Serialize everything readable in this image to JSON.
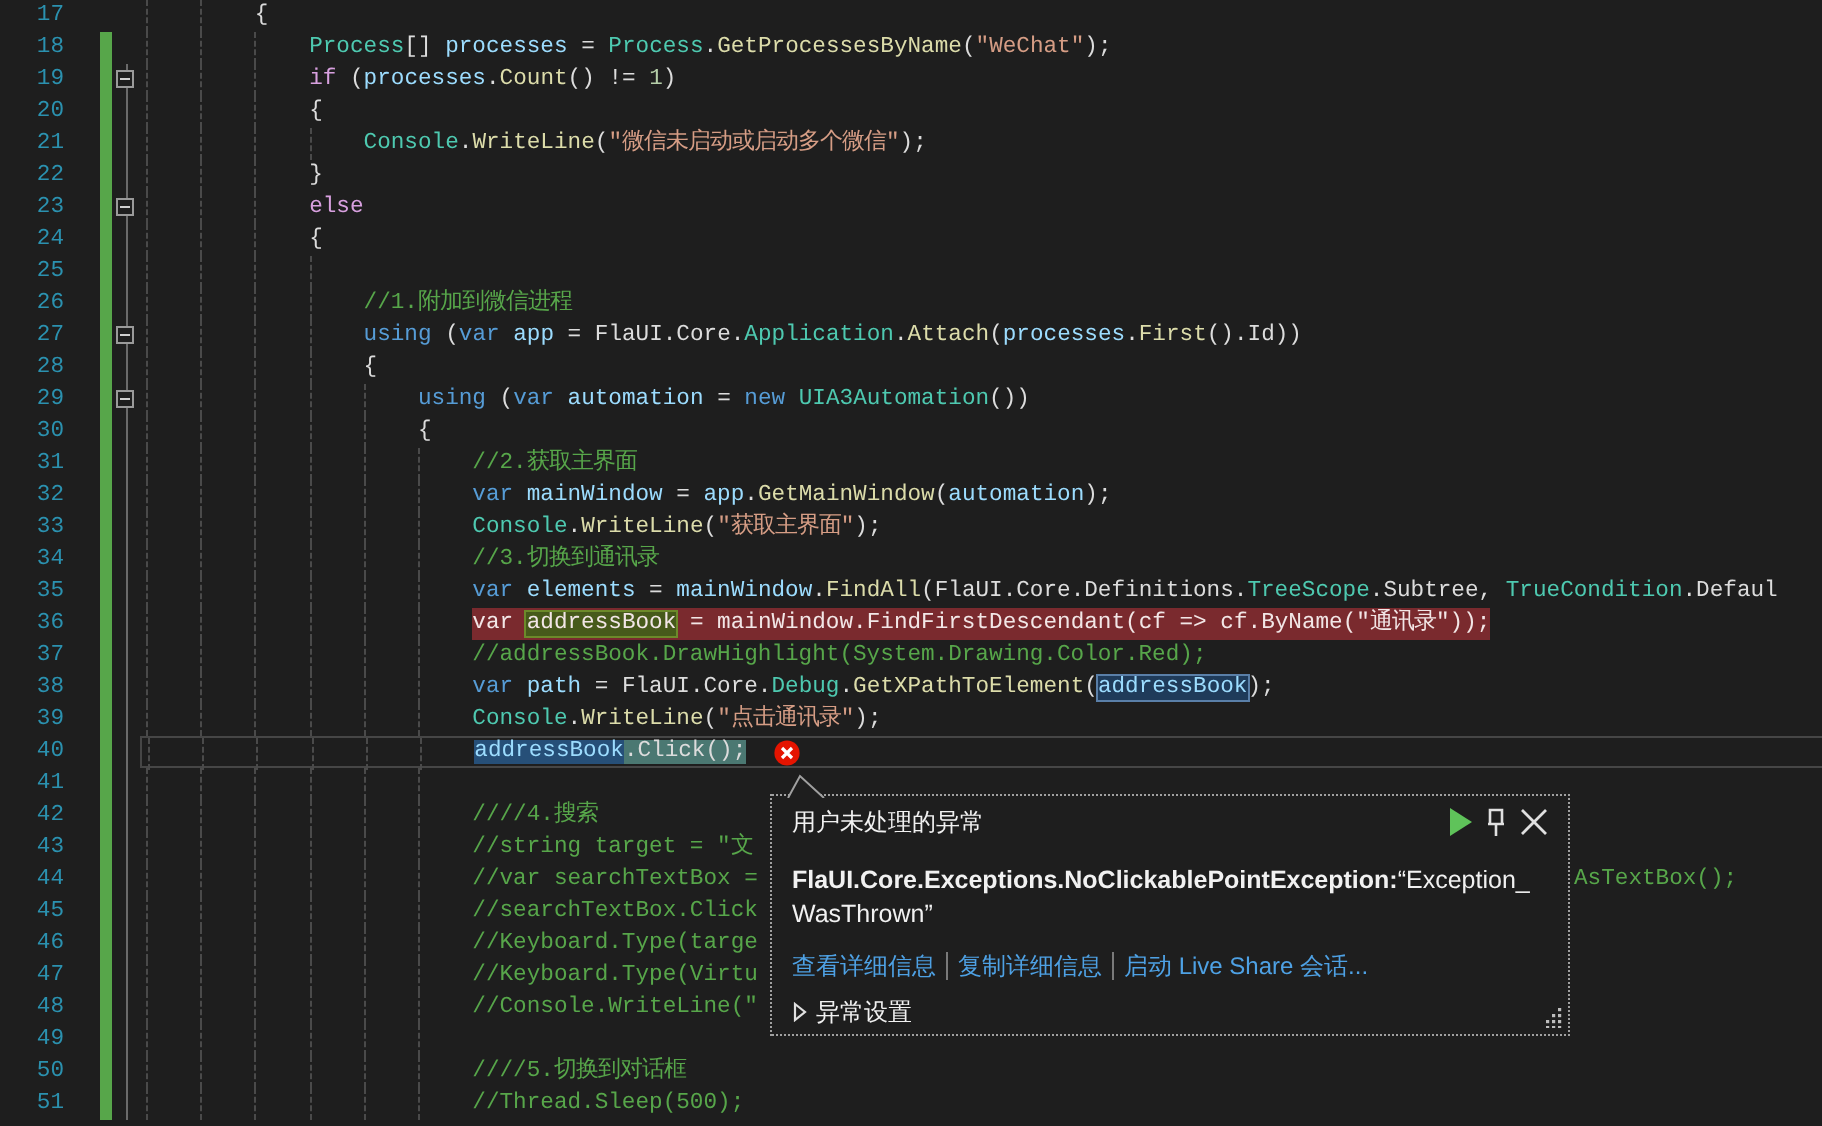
{
  "lines": [
    {
      "number": "17",
      "changed": false,
      "fold": false,
      "tokens": [
        {
          "text": "        {",
          "kind": "plain"
        }
      ]
    },
    {
      "number": "18",
      "changed": true,
      "fold": false,
      "tokens": [
        {
          "text": "            Process",
          "kind": "type"
        },
        {
          "text": "[] ",
          "kind": "plain"
        },
        {
          "text": "processes",
          "kind": "variable"
        },
        {
          "text": " = ",
          "kind": "plain"
        },
        {
          "text": "Process",
          "kind": "type"
        },
        {
          "text": ".",
          "kind": "plain"
        },
        {
          "text": "GetProcessesByName",
          "kind": "method"
        },
        {
          "text": "(",
          "kind": "plain"
        },
        {
          "text": "\"WeChat\"",
          "kind": "string"
        },
        {
          "text": ");",
          "kind": "plain"
        }
      ]
    },
    {
      "number": "19",
      "changed": true,
      "fold": true,
      "tokens": [
        {
          "text": "            if",
          "kind": "control"
        },
        {
          "text": " (",
          "kind": "plain"
        },
        {
          "text": "processes",
          "kind": "variable"
        },
        {
          "text": ".",
          "kind": "plain"
        },
        {
          "text": "Count",
          "kind": "method"
        },
        {
          "text": "() != ",
          "kind": "plain"
        },
        {
          "text": "1",
          "kind": "number"
        },
        {
          "text": ")",
          "kind": "plain"
        }
      ]
    },
    {
      "number": "20",
      "changed": true,
      "fold": false,
      "tokens": [
        {
          "text": "            {",
          "kind": "plain"
        }
      ]
    },
    {
      "number": "21",
      "changed": true,
      "fold": false,
      "tokens": [
        {
          "text": "                Console",
          "kind": "type"
        },
        {
          "text": ".",
          "kind": "plain"
        },
        {
          "text": "WriteLine",
          "kind": "method"
        },
        {
          "text": "(",
          "kind": "plain"
        },
        {
          "text": "\"微信未启动或启动多个微信\"",
          "kind": "string"
        },
        {
          "text": ");",
          "kind": "plain"
        }
      ]
    },
    {
      "number": "22",
      "changed": true,
      "fold": false,
      "tokens": [
        {
          "text": "            }",
          "kind": "plain"
        }
      ]
    },
    {
      "number": "23",
      "changed": true,
      "fold": true,
      "tokens": [
        {
          "text": "            else",
          "kind": "control"
        }
      ]
    },
    {
      "number": "24",
      "changed": true,
      "fold": false,
      "tokens": [
        {
          "text": "            {",
          "kind": "plain"
        }
      ]
    },
    {
      "number": "25",
      "changed": true,
      "fold": false
    },
    {
      "number": "26",
      "changed": true,
      "fold": false,
      "tokens": [
        {
          "text": "                //1.附加到微信进程",
          "kind": "comment"
        }
      ]
    },
    {
      "number": "27",
      "changed": true,
      "fold": true,
      "tokens": [
        {
          "text": "                using",
          "kind": "keyword"
        },
        {
          "text": " (",
          "kind": "plain"
        },
        {
          "text": "var ",
          "kind": "keyword"
        },
        {
          "text": "app",
          "kind": "variable"
        },
        {
          "text": " = FlaUI.Core.",
          "kind": "plain"
        },
        {
          "text": "Application",
          "kind": "type"
        },
        {
          "text": ".",
          "kind": "plain"
        },
        {
          "text": "Attach",
          "kind": "method"
        },
        {
          "text": "(",
          "kind": "plain"
        },
        {
          "text": "processes",
          "kind": "variable"
        },
        {
          "text": ".",
          "kind": "plain"
        },
        {
          "text": "First",
          "kind": "method"
        },
        {
          "text": "().Id))",
          "kind": "plain"
        }
      ]
    },
    {
      "number": "28",
      "changed": true,
      "fold": false,
      "tokens": [
        {
          "text": "                {",
          "kind": "plain"
        }
      ]
    },
    {
      "number": "29",
      "changed": true,
      "fold": true,
      "tokens": [
        {
          "text": "                    using",
          "kind": "keyword"
        },
        {
          "text": " (",
          "kind": "plain"
        },
        {
          "text": "var ",
          "kind": "keyword"
        },
        {
          "text": "automation",
          "kind": "variable"
        },
        {
          "text": " = ",
          "kind": "plain"
        },
        {
          "text": "new ",
          "kind": "keyword"
        },
        {
          "text": "UIA3Automation",
          "kind": "type"
        },
        {
          "text": "())",
          "kind": "plain"
        }
      ]
    },
    {
      "number": "30",
      "changed": true,
      "fold": false,
      "tokens": [
        {
          "text": "                    {",
          "kind": "plain"
        }
      ]
    },
    {
      "number": "31",
      "changed": true,
      "fold": false,
      "tokens": [
        {
          "text": "                        //2.获取主界面",
          "kind": "comment"
        }
      ]
    },
    {
      "number": "32",
      "changed": true,
      "fold": false,
      "tokens": [
        {
          "text": "                        var ",
          "kind": "keyword"
        },
        {
          "text": "mainWindow",
          "kind": "variable"
        },
        {
          "text": " = ",
          "kind": "plain"
        },
        {
          "text": "app",
          "kind": "variable"
        },
        {
          "text": ".",
          "kind": "plain"
        },
        {
          "text": "GetMainWindow",
          "kind": "method"
        },
        {
          "text": "(",
          "kind": "plain"
        },
        {
          "text": "automation",
          "kind": "variable"
        },
        {
          "text": ");",
          "kind": "plain"
        }
      ]
    },
    {
      "number": "33",
      "changed": true,
      "fold": false,
      "tokens": [
        {
          "text": "                        Console",
          "kind": "type"
        },
        {
          "text": ".",
          "kind": "plain"
        },
        {
          "text": "WriteLine",
          "kind": "method"
        },
        {
          "text": "(",
          "kind": "plain"
        },
        {
          "text": "\"获取主界面\"",
          "kind": "string"
        },
        {
          "text": ");",
          "kind": "plain"
        }
      ]
    },
    {
      "number": "34",
      "changed": true,
      "fold": false,
      "tokens": [
        {
          "text": "                        //3.切换到通讯录",
          "kind": "comment"
        }
      ]
    },
    {
      "number": "35",
      "changed": true,
      "fold": false,
      "tokens": [
        {
          "text": "                        var ",
          "kind": "keyword"
        },
        {
          "text": "elements",
          "kind": "variable"
        },
        {
          "text": " = ",
          "kind": "plain"
        },
        {
          "text": "mainWindow",
          "kind": "variable"
        },
        {
          "text": ".",
          "kind": "plain"
        },
        {
          "text": "FindAll",
          "kind": "method"
        },
        {
          "text": "(FlaUI.Core.Definitions.",
          "kind": "plain"
        },
        {
          "text": "TreeScope",
          "kind": "type"
        },
        {
          "text": ".Subtree, ",
          "kind": "plain"
        },
        {
          "text": "TrueCondition",
          "kind": "type"
        },
        {
          "text": ".Defaul",
          "kind": "plain"
        }
      ]
    },
    {
      "number": "36",
      "changed": true,
      "fold": false,
      "error": true,
      "tokens": [
        {
          "text": "                        var ",
          "kind": "keyword"
        },
        {
          "text": "addressBook",
          "kind": "variable",
          "write_reference": true
        },
        {
          "text": " = ",
          "kind": "plain"
        },
        {
          "text": "mainWindow",
          "kind": "variable"
        },
        {
          "text": ".",
          "kind": "plain"
        },
        {
          "text": "FindFirstDescendant",
          "kind": "method"
        },
        {
          "text": "(",
          "kind": "plain"
        },
        {
          "text": "cf",
          "kind": "variable"
        },
        {
          "text": " => ",
          "kind": "plain"
        },
        {
          "text": "cf",
          "kind": "variable"
        },
        {
          "text": ".",
          "kind": "plain"
        },
        {
          "text": "ByName",
          "kind": "method"
        },
        {
          "text": "(",
          "kind": "plain"
        },
        {
          "text": "\"通讯录\"",
          "kind": "string"
        },
        {
          "text": "));",
          "kind": "plain"
        }
      ]
    },
    {
      "number": "37",
      "changed": true,
      "fold": false,
      "tokens": [
        {
          "text": "                        //addressBook.DrawHighlight(System.Drawing.Color.Red);",
          "kind": "comment"
        }
      ]
    },
    {
      "number": "38",
      "changed": true,
      "fold": false,
      "tokens": [
        {
          "text": "                        var ",
          "kind": "keyword"
        },
        {
          "text": "path",
          "kind": "variable"
        },
        {
          "text": " = FlaUI.Core.",
          "kind": "plain"
        },
        {
          "text": "Debug",
          "kind": "type"
        },
        {
          "text": ".",
          "kind": "plain"
        },
        {
          "text": "GetXPathToElement",
          "kind": "method"
        },
        {
          "text": "(",
          "kind": "plain"
        },
        {
          "text": "addressBook",
          "kind": "variable",
          "reference": true
        },
        {
          "text": ");",
          "kind": "plain"
        }
      ]
    },
    {
      "number": "39",
      "changed": true,
      "fold": false,
      "tokens": [
        {
          "text": "                        Console",
          "kind": "type"
        },
        {
          "text": ".",
          "kind": "plain"
        },
        {
          "text": "WriteLine",
          "kind": "method"
        },
        {
          "text": "(",
          "kind": "plain"
        },
        {
          "text": "\"点击通讯录\"",
          "kind": "string"
        },
        {
          "text": ");",
          "kind": "plain"
        }
      ]
    },
    {
      "number": "40",
      "changed": true,
      "fold": false,
      "current": true,
      "tokens": [
        {
          "text": "                        addressBook",
          "kind": "variable",
          "selection": true
        },
        {
          "text": ".Click();",
          "kind": "plain",
          "statement": true
        }
      ]
    },
    {
      "number": "41",
      "changed": true,
      "fold": false
    },
    {
      "number": "42",
      "changed": true,
      "fold": false,
      "tokens": [
        {
          "text": "                        ////4.搜索",
          "kind": "comment"
        }
      ]
    },
    {
      "number": "43",
      "changed": true,
      "fold": false,
      "tokens": [
        {
          "text": "                        //string target = \"文",
          "kind": "comment"
        }
      ]
    },
    {
      "number": "44",
      "changed": true,
      "fold": false,
      "tokens": [
        {
          "text": "                        //var searchTextBox =",
          "kind": "comment"
        }
      ],
      "tail": {
        "text": "AsTextBox();",
        "kind": "comment"
      }
    },
    {
      "number": "45",
      "changed": true,
      "fold": false,
      "tokens": [
        {
          "text": "                        //searchTextBox.Click",
          "kind": "comment"
        }
      ]
    },
    {
      "number": "46",
      "changed": true,
      "fold": false,
      "tokens": [
        {
          "text": "                        //Keyboard.Type(targe",
          "kind": "comment"
        }
      ]
    },
    {
      "number": "47",
      "changed": true,
      "fold": false,
      "tokens": [
        {
          "text": "                        //Keyboard.Type(Virtu",
          "kind": "comment"
        }
      ]
    },
    {
      "number": "48",
      "changed": true,
      "fold": false,
      "tokens": [
        {
          "text": "                        //Console.WriteLine(\"",
          "kind": "comment"
        }
      ]
    },
    {
      "number": "49",
      "changed": true,
      "fold": false
    },
    {
      "number": "50",
      "changed": true,
      "fold": false,
      "tokens": [
        {
          "text": "                        ////5.切换到对话框",
          "kind": "comment"
        }
      ]
    },
    {
      "number": "51",
      "changed": true,
      "fold": false,
      "tokens": [
        {
          "text": "                        //Thread.Sleep(500);",
          "kind": "comment"
        }
      ]
    }
  ],
  "exception_popup": {
    "title": "用户未处理的异常",
    "message": "**FlaUI.Core.Exceptions.NoClickablePointException:**“Exception_WasThrown”",
    "links": [
      "查看详细信息",
      "复制详细信息",
      "启动 Live Share 会话..."
    ],
    "settings": {
      "label": "异常设置",
      "expanded": false
    }
  }
}
